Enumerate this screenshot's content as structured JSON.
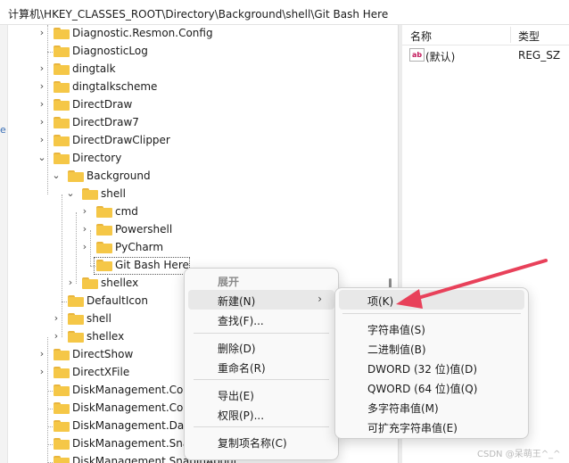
{
  "address_bar": "计算机\\HKEY_CLASSES_ROOT\\Directory\\Background\\shell\\Git Bash Here",
  "values_pane": {
    "col_name": "名称",
    "col_type": "类型",
    "rows": [
      {
        "name": "(默认)",
        "type": "REG_SZ",
        "icon_text": "ab"
      }
    ]
  },
  "tree": {
    "items": [
      {
        "label": "Diagnostic.Resmon.Config"
      },
      {
        "label": "DiagnosticLog"
      },
      {
        "label": "dingtalk"
      },
      {
        "label": "dingtalkscheme"
      },
      {
        "label": "DirectDraw"
      },
      {
        "label": "DirectDraw7"
      },
      {
        "label": "DirectDrawClipper"
      },
      {
        "label": "Directory"
      },
      {
        "label": "Background"
      },
      {
        "label": "shell"
      },
      {
        "label": "cmd"
      },
      {
        "label": "Powershell"
      },
      {
        "label": "PyCharm"
      },
      {
        "label": "Git Bash Here"
      },
      {
        "label": "shellex"
      },
      {
        "label": "DefaultIcon"
      },
      {
        "label": "shell"
      },
      {
        "label": "shellex"
      },
      {
        "label": "DirectShow"
      },
      {
        "label": "DirectXFile"
      },
      {
        "label": "DiskManagement.Cor"
      },
      {
        "label": "DiskManagement.Cor"
      },
      {
        "label": "DiskManagement.Dat"
      },
      {
        "label": "DiskManagement.Sna"
      },
      {
        "label": "DiskManagement.SnapInAbout"
      }
    ]
  },
  "context_menu": {
    "items": [
      {
        "label": "展开"
      },
      {
        "label": "新建(N)"
      },
      {
        "label": "查找(F)..."
      },
      {
        "label": "删除(D)"
      },
      {
        "label": "重命名(R)"
      },
      {
        "label": "导出(E)"
      },
      {
        "label": "权限(P)..."
      },
      {
        "label": "复制项名称(C)"
      }
    ]
  },
  "submenu": {
    "items": [
      {
        "label": "项(K)"
      },
      {
        "label": "字符串值(S)"
      },
      {
        "label": "二进制值(B)"
      },
      {
        "label": "DWORD (32 位)值(D)"
      },
      {
        "label": "QWORD (64 位)值(Q)"
      },
      {
        "label": "多字符串值(M)"
      },
      {
        "label": "可扩充字符串值(E)"
      }
    ]
  },
  "watermark": "CSDN @呆萌王^_^",
  "colors": {
    "folder": "#f5c747",
    "arrow": "#e8415a",
    "highlight": "#e8e8e8"
  }
}
